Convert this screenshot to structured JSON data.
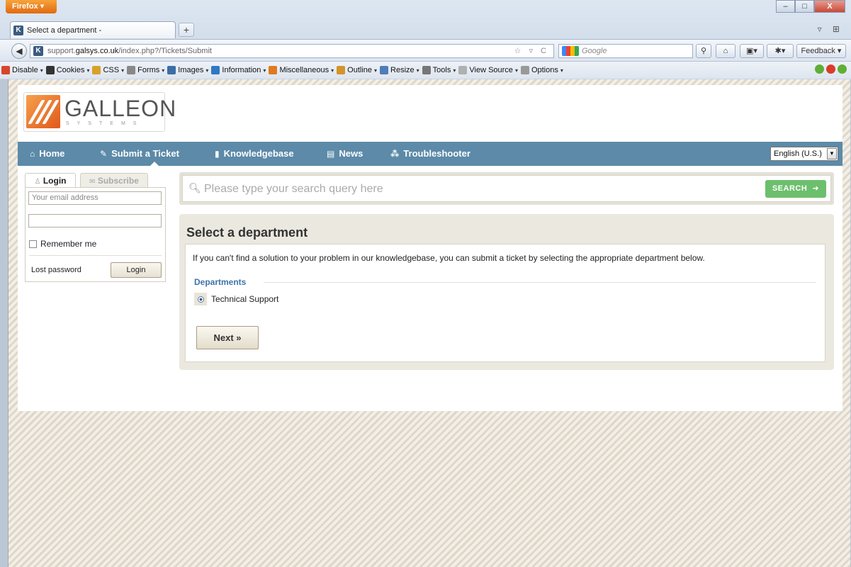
{
  "window": {
    "app_button": "Firefox ▾",
    "controls": [
      "–",
      "□",
      "X"
    ]
  },
  "tab": {
    "favicon": "K",
    "title": "Select a department -",
    "new_tab": "+",
    "right_icons": "▿ ⊞"
  },
  "navbar": {
    "back": "◀",
    "url_prefix": "support.",
    "url_domain": "galsys.co.uk",
    "url_path": "/index.php?/Tickets/Submit",
    "url_icons": "☆ ▿ C",
    "search_placeholder": "Google",
    "search_icon": "⚲",
    "home": "⌂",
    "feedback": "Feedback ▾"
  },
  "webdev_toolbar": {
    "items": [
      {
        "label": "Disable",
        "icon": "#d9452c"
      },
      {
        "label": "Cookies",
        "icon": "#333333"
      },
      {
        "label": "CSS",
        "icon": "#d8a12b"
      },
      {
        "label": "Forms",
        "icon": "#888888"
      },
      {
        "label": "Images",
        "icon": "#3b6ea5"
      },
      {
        "label": "Information",
        "icon": "#2f78c4"
      },
      {
        "label": "Miscellaneous",
        "icon": "#e07a1f"
      },
      {
        "label": "Outline",
        "icon": "#d3952b"
      },
      {
        "label": "Resize",
        "icon": "#4f7db8"
      },
      {
        "label": "Tools",
        "icon": "#777777"
      },
      {
        "label": "View Source",
        "icon": "#b0b0b0"
      },
      {
        "label": "Options",
        "icon": "#999999"
      }
    ],
    "status_colors": [
      "#5fae35",
      "#d83d2a",
      "#5fae35"
    ]
  },
  "site": {
    "logo_text": "GALLEON",
    "logo_sub": "SYSTEMS",
    "nav": [
      {
        "label": "Home",
        "icon": "⌂"
      },
      {
        "label": "Submit a Ticket",
        "icon": "✎"
      },
      {
        "label": "Knowledgebase",
        "icon": "▮"
      },
      {
        "label": "News",
        "icon": "▤"
      },
      {
        "label": "Troubleshooter",
        "icon": "⁂"
      }
    ],
    "language": "English (U.S.)",
    "accent": "#5c8aa8"
  },
  "sidebar": {
    "tab_login": "Login",
    "tab_subscribe": "Subscribe",
    "email_placeholder": "Your email address",
    "password_value": "",
    "remember_me": "Remember me",
    "lost_password": "Lost password",
    "login_button": "Login"
  },
  "search": {
    "placeholder": "Please type your search query here",
    "button": "SEARCH"
  },
  "main": {
    "title": "Select a department",
    "intro": "If you can't find a solution to your problem in our knowledgebase, you can submit a ticket by selecting the appropriate department below.",
    "departments_label": "Departments",
    "departments": [
      {
        "label": "Technical Support",
        "selected": true
      }
    ],
    "next_button": "Next »"
  }
}
